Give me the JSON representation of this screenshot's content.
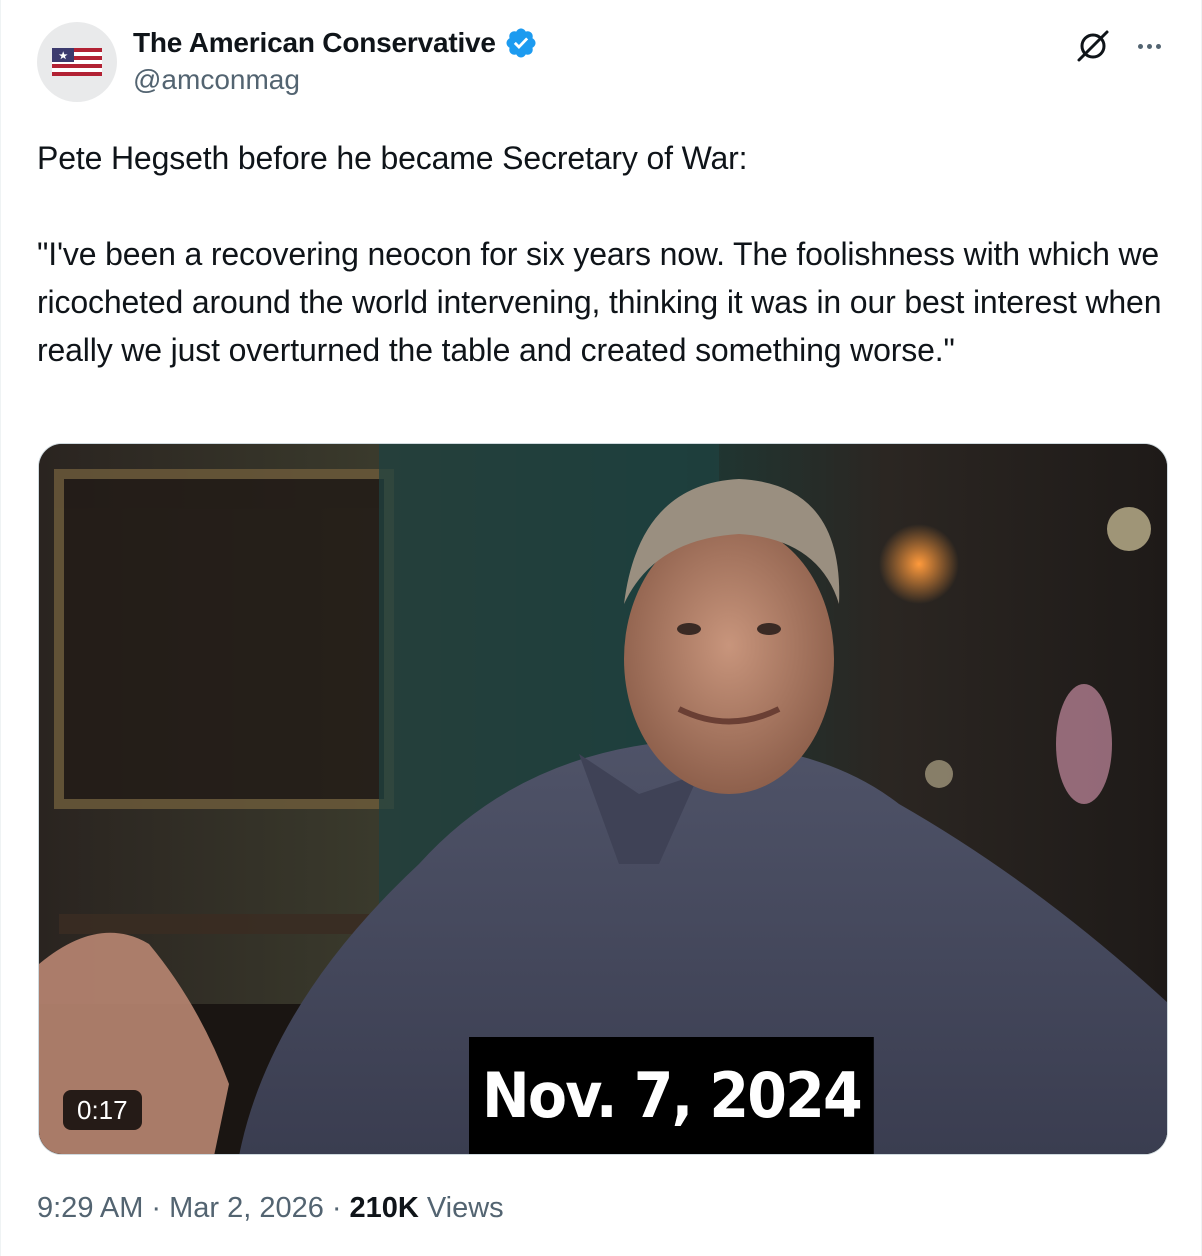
{
  "author": {
    "display_name": "The American Conservative",
    "handle": "@amconmag",
    "verified": true,
    "verified_color": "#1d9bf0",
    "avatar_icon": "american-flag"
  },
  "actions": {
    "grok_icon": "grok-icon",
    "more_icon": "more-horizontal-icon"
  },
  "tweet": {
    "line_1": "Pete Hegseth before he became Secretary of War:",
    "quote": "\"I've been a recovering neocon for six years now. The foolishness with which we ricocheted around the world intervening, thinking it was in our best interest when really we just overturned the table and created something worse.\""
  },
  "media": {
    "duration": "0:17",
    "caption": "Nov. 7, 2024"
  },
  "meta": {
    "time": "9:29 AM",
    "date": "Mar 2, 2026",
    "separator": "·",
    "views_count": "210K",
    "views_label": "Views"
  },
  "colors": {
    "text_primary": "#0f1419",
    "text_secondary": "#536471",
    "border": "#cfd9de"
  }
}
